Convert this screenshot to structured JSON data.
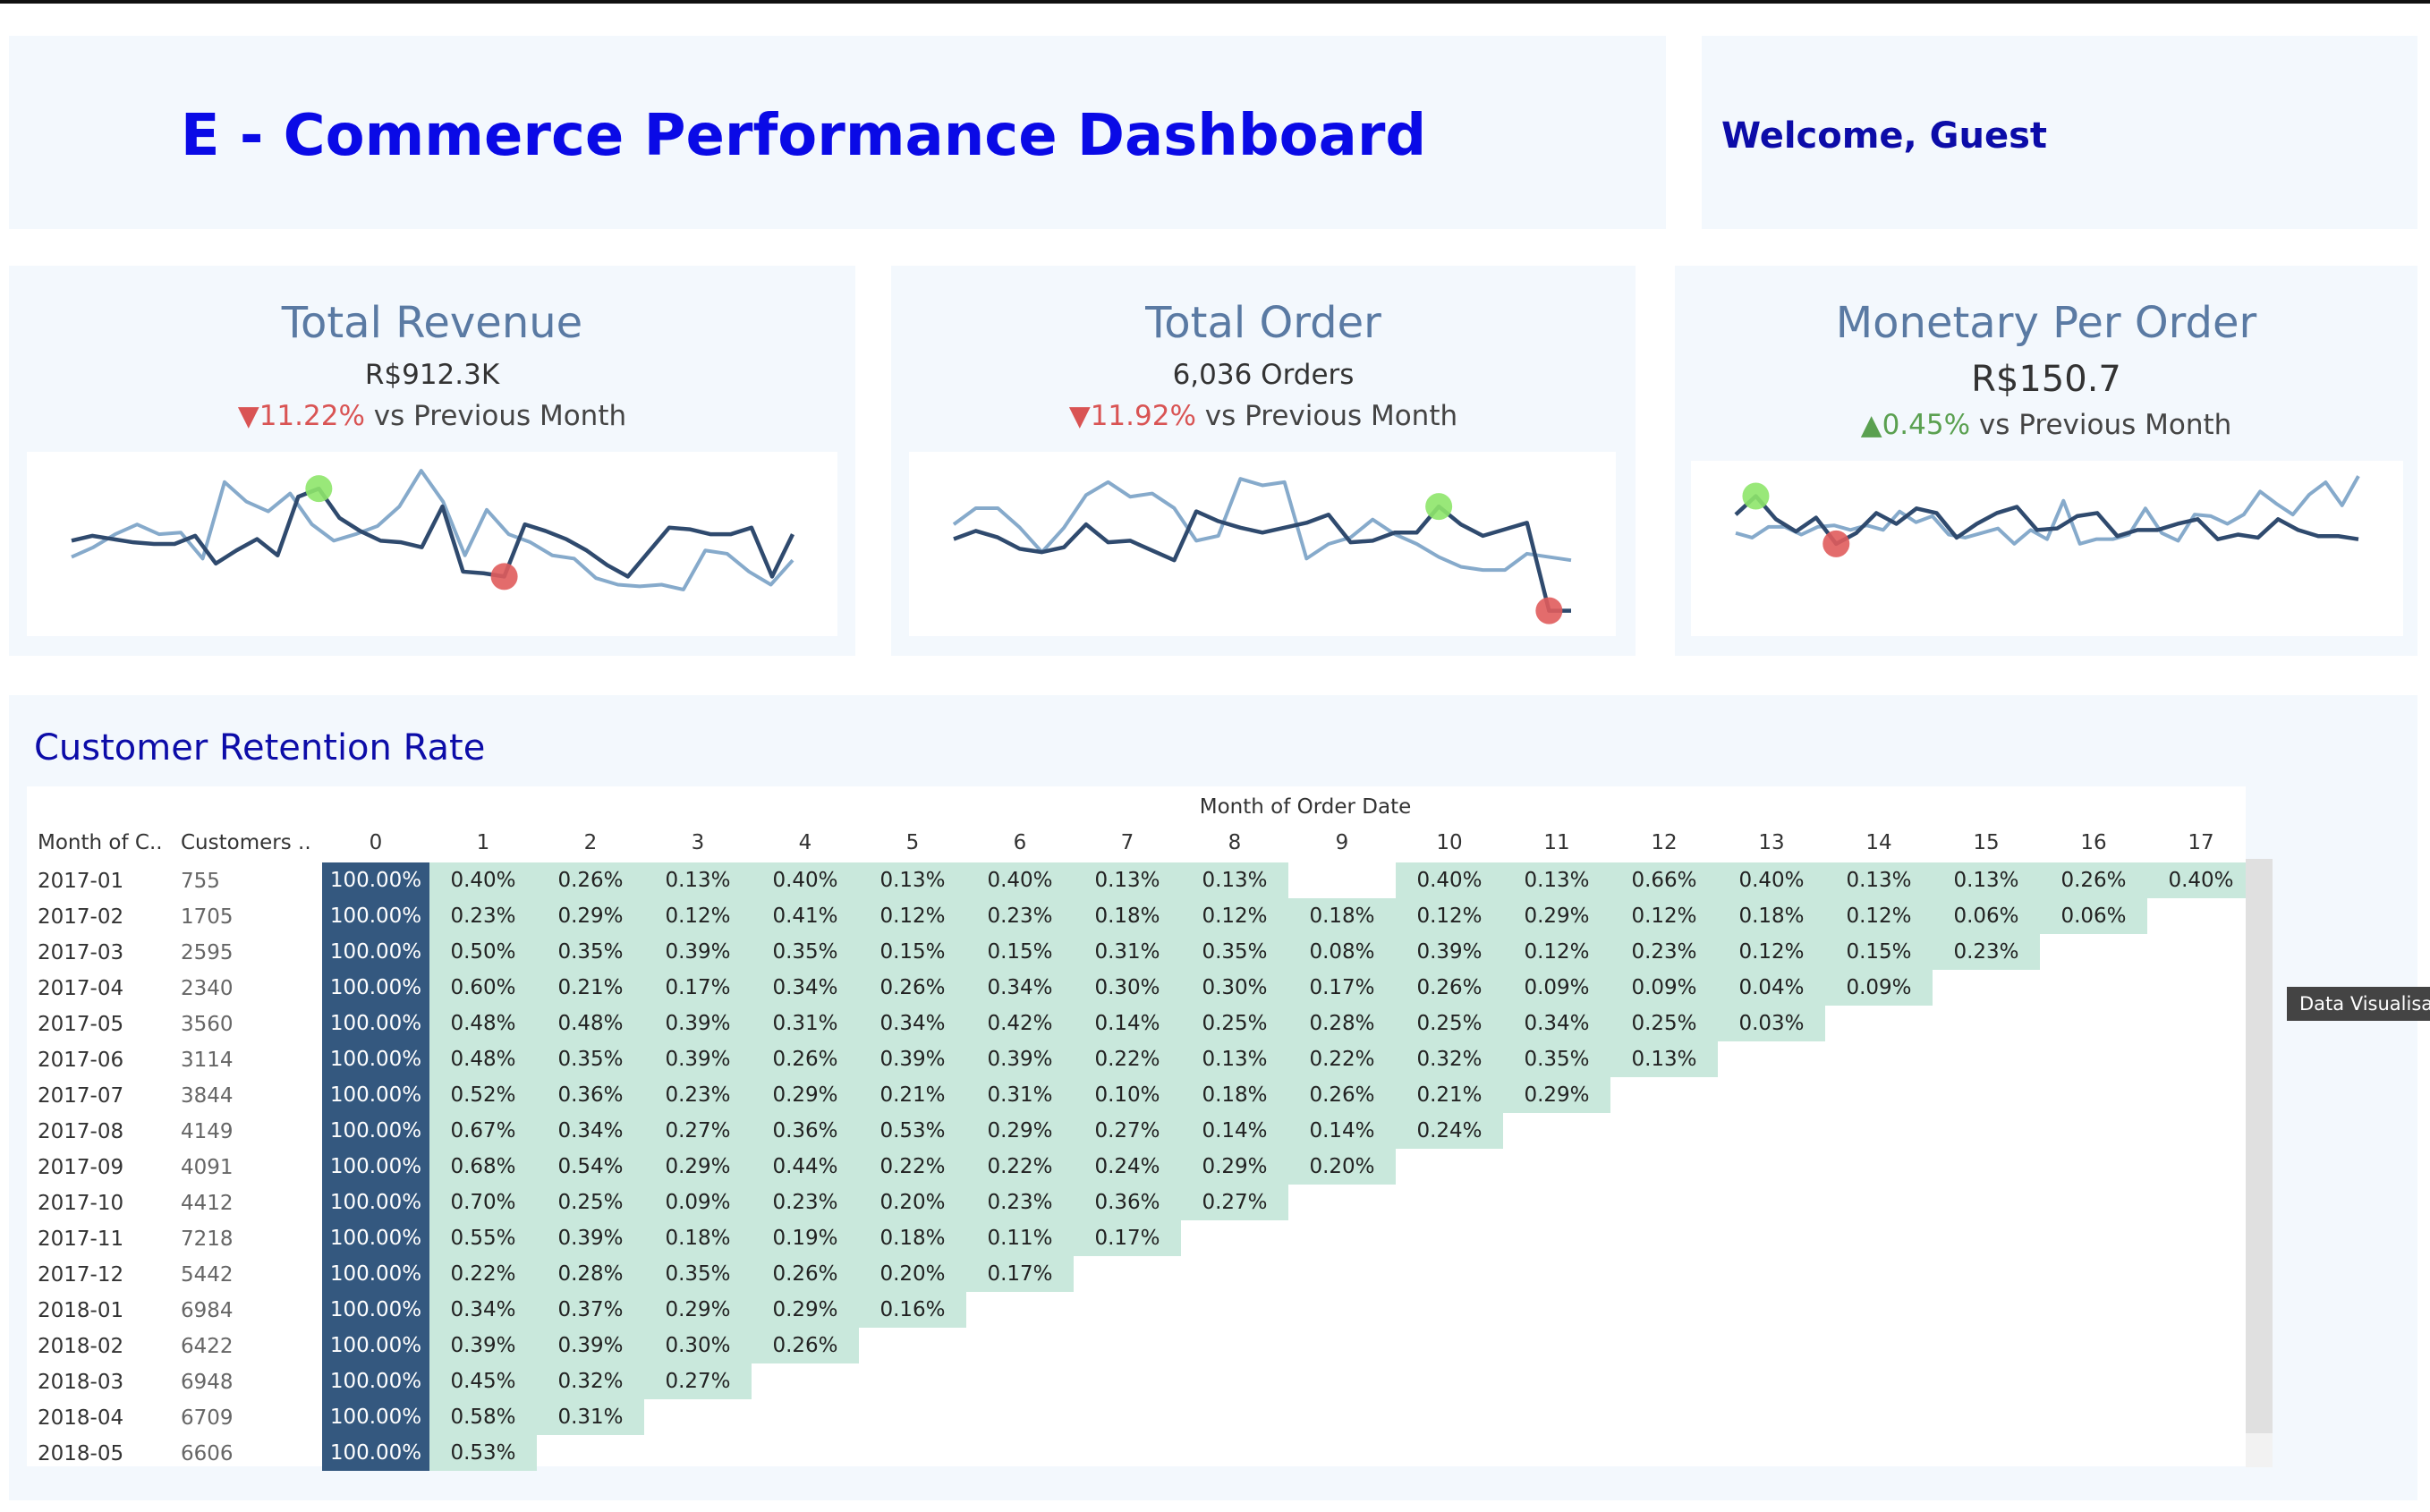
{
  "header": {
    "title": "E - Commerce Performance Dashboard",
    "welcome": "Welcome, Guest"
  },
  "kpis": [
    {
      "title": "Total Revenue",
      "value": "R$912.3K",
      "delta_symbol": "▼",
      "delta_value": "11.22%",
      "delta_direction": "negative",
      "delta_suffix": " vs Previous Month",
      "spark_current": [
        0.52,
        0.55,
        0.53,
        0.51,
        0.5,
        0.5,
        0.55,
        0.38,
        0.46,
        0.53,
        0.43,
        0.79,
        0.84,
        0.66,
        0.58,
        0.52,
        0.51,
        0.48,
        0.73,
        0.33,
        0.32,
        0.3,
        0.62,
        0.58,
        0.53,
        0.46,
        0.37,
        0.3,
        0.45,
        0.6,
        0.59,
        0.56,
        0.56,
        0.6,
        0.3,
        0.56
      ],
      "spark_previous": [
        0.42,
        0.48,
        0.56,
        0.62,
        0.56,
        0.57,
        0.41,
        0.88,
        0.76,
        0.7,
        0.81,
        0.62,
        0.52,
        0.56,
        0.61,
        0.73,
        0.95,
        0.76,
        0.43,
        0.71,
        0.56,
        0.51,
        0.43,
        0.41,
        0.29,
        0.25,
        0.24,
        0.25,
        0.22,
        0.46,
        0.44,
        0.33,
        0.25,
        0.4
      ],
      "marker_high": "green",
      "marker_low": "red"
    },
    {
      "title": "Total Order",
      "value": "6,036 Orders",
      "delta_symbol": "▼",
      "delta_value": "11.92%",
      "delta_direction": "negative",
      "delta_suffix": " vs Previous Month",
      "spark_current": [
        0.53,
        0.58,
        0.54,
        0.47,
        0.45,
        0.48,
        0.62,
        0.51,
        0.52,
        0.46,
        0.4,
        0.7,
        0.64,
        0.6,
        0.57,
        0.6,
        0.63,
        0.68,
        0.51,
        0.52,
        0.57,
        0.57,
        0.73,
        0.62,
        0.55,
        0.59,
        0.63,
        0.09,
        0.09
      ],
      "spark_previous": [
        0.62,
        0.72,
        0.72,
        0.6,
        0.45,
        0.6,
        0.8,
        0.88,
        0.79,
        0.81,
        0.72,
        0.52,
        0.55,
        0.9,
        0.86,
        0.88,
        0.41,
        0.5,
        0.54,
        0.65,
        0.56,
        0.5,
        0.42,
        0.36,
        0.34,
        0.34,
        0.44,
        0.42,
        0.4
      ],
      "marker_high": "green",
      "marker_low": "red"
    },
    {
      "title": "Monetary Per Order",
      "value": "R$150.7",
      "delta_symbol": "▲",
      "delta_value": "0.45%",
      "delta_direction": "positive",
      "delta_suffix": " vs Previous Month",
      "spark_current": [
        0.72,
        0.84,
        0.69,
        0.61,
        0.7,
        0.53,
        0.6,
        0.73,
        0.66,
        0.76,
        0.73,
        0.57,
        0.66,
        0.73,
        0.77,
        0.62,
        0.63,
        0.71,
        0.73,
        0.58,
        0.62,
        0.62,
        0.66,
        0.69,
        0.56,
        0.59,
        0.57,
        0.69,
        0.62,
        0.58,
        0.58,
        0.56
      ],
      "spark_previous": [
        0.6,
        0.57,
        0.64,
        0.64,
        0.59,
        0.64,
        0.65,
        0.62,
        0.65,
        0.62,
        0.74,
        0.67,
        0.71,
        0.59,
        0.57,
        0.6,
        0.63,
        0.53,
        0.62,
        0.56,
        0.81,
        0.53,
        0.56,
        0.56,
        0.59,
        0.76,
        0.6,
        0.55,
        0.72,
        0.71,
        0.66,
        0.72,
        0.87,
        0.79,
        0.72,
        0.85,
        0.93,
        0.78,
        0.97
      ],
      "marker_high": "green",
      "marker_low": "red"
    }
  ],
  "retention": {
    "title": "Customer Retention Rate",
    "axis_title": "Month of Order Date",
    "col_month": "Month of C..",
    "col_customers": "Customers ..",
    "periods": [
      "0",
      "1",
      "2",
      "3",
      "4",
      "5",
      "6",
      "7",
      "8",
      "9",
      "10",
      "11",
      "12",
      "13",
      "14",
      "15",
      "16",
      "17"
    ],
    "rows": [
      {
        "month": "2017-01",
        "customers": "755",
        "values": [
          "100.00%",
          "0.40%",
          "0.26%",
          "0.13%",
          "0.40%",
          "0.13%",
          "0.40%",
          "0.13%",
          "0.13%",
          "",
          "0.40%",
          "0.13%",
          "0.66%",
          "0.40%",
          "0.13%",
          "0.13%",
          "0.26%",
          "0.40%"
        ]
      },
      {
        "month": "2017-02",
        "customers": "1705",
        "values": [
          "100.00%",
          "0.23%",
          "0.29%",
          "0.12%",
          "0.41%",
          "0.12%",
          "0.23%",
          "0.18%",
          "0.12%",
          "0.18%",
          "0.12%",
          "0.29%",
          "0.12%",
          "0.18%",
          "0.12%",
          "0.06%",
          "0.06%"
        ]
      },
      {
        "month": "2017-03",
        "customers": "2595",
        "values": [
          "100.00%",
          "0.50%",
          "0.35%",
          "0.39%",
          "0.35%",
          "0.15%",
          "0.15%",
          "0.31%",
          "0.35%",
          "0.08%",
          "0.39%",
          "0.12%",
          "0.23%",
          "0.12%",
          "0.15%",
          "0.23%"
        ]
      },
      {
        "month": "2017-04",
        "customers": "2340",
        "values": [
          "100.00%",
          "0.60%",
          "0.21%",
          "0.17%",
          "0.34%",
          "0.26%",
          "0.34%",
          "0.30%",
          "0.30%",
          "0.17%",
          "0.26%",
          "0.09%",
          "0.09%",
          "0.04%",
          "0.09%"
        ]
      },
      {
        "month": "2017-05",
        "customers": "3560",
        "values": [
          "100.00%",
          "0.48%",
          "0.48%",
          "0.39%",
          "0.31%",
          "0.34%",
          "0.42%",
          "0.14%",
          "0.25%",
          "0.28%",
          "0.25%",
          "0.34%",
          "0.25%",
          "0.03%"
        ]
      },
      {
        "month": "2017-06",
        "customers": "3114",
        "values": [
          "100.00%",
          "0.48%",
          "0.35%",
          "0.39%",
          "0.26%",
          "0.39%",
          "0.39%",
          "0.22%",
          "0.13%",
          "0.22%",
          "0.32%",
          "0.35%",
          "0.13%"
        ]
      },
      {
        "month": "2017-07",
        "customers": "3844",
        "values": [
          "100.00%",
          "0.52%",
          "0.36%",
          "0.23%",
          "0.29%",
          "0.21%",
          "0.31%",
          "0.10%",
          "0.18%",
          "0.26%",
          "0.21%",
          "0.29%"
        ]
      },
      {
        "month": "2017-08",
        "customers": "4149",
        "values": [
          "100.00%",
          "0.67%",
          "0.34%",
          "0.27%",
          "0.36%",
          "0.53%",
          "0.29%",
          "0.27%",
          "0.14%",
          "0.14%",
          "0.24%"
        ]
      },
      {
        "month": "2017-09",
        "customers": "4091",
        "values": [
          "100.00%",
          "0.68%",
          "0.54%",
          "0.29%",
          "0.44%",
          "0.22%",
          "0.22%",
          "0.24%",
          "0.29%",
          "0.20%"
        ]
      },
      {
        "month": "2017-10",
        "customers": "4412",
        "values": [
          "100.00%",
          "0.70%",
          "0.25%",
          "0.09%",
          "0.23%",
          "0.20%",
          "0.23%",
          "0.36%",
          "0.27%"
        ]
      },
      {
        "month": "2017-11",
        "customers": "7218",
        "values": [
          "100.00%",
          "0.55%",
          "0.39%",
          "0.18%",
          "0.19%",
          "0.18%",
          "0.11%",
          "0.17%"
        ]
      },
      {
        "month": "2017-12",
        "customers": "5442",
        "values": [
          "100.00%",
          "0.22%",
          "0.28%",
          "0.35%",
          "0.26%",
          "0.20%",
          "0.17%"
        ]
      },
      {
        "month": "2018-01",
        "customers": "6984",
        "values": [
          "100.00%",
          "0.34%",
          "0.37%",
          "0.29%",
          "0.29%",
          "0.16%"
        ]
      },
      {
        "month": "2018-02",
        "customers": "6422",
        "values": [
          "100.00%",
          "0.39%",
          "0.39%",
          "0.30%",
          "0.26%"
        ]
      },
      {
        "month": "2018-03",
        "customers": "6948",
        "values": [
          "100.00%",
          "0.45%",
          "0.32%",
          "0.27%"
        ]
      },
      {
        "month": "2018-04",
        "customers": "6709",
        "values": [
          "100.00%",
          "0.58%",
          "0.31%"
        ]
      },
      {
        "month": "2018-05",
        "customers": "6606",
        "values": [
          "100.00%",
          "0.53%"
        ]
      }
    ]
  },
  "tooltip": "Data Visualisa",
  "colors": {
    "title": "#0a0ae6",
    "welcome": "#0c0ca8",
    "kpi_title": "#5a7aa3",
    "negative": "#d95454",
    "positive": "#5aa050",
    "cohort_base": "#34587f",
    "cohort_cell": "#c9e8dc",
    "line_current": "#2f4a6e",
    "line_previous": "#86aacb"
  }
}
